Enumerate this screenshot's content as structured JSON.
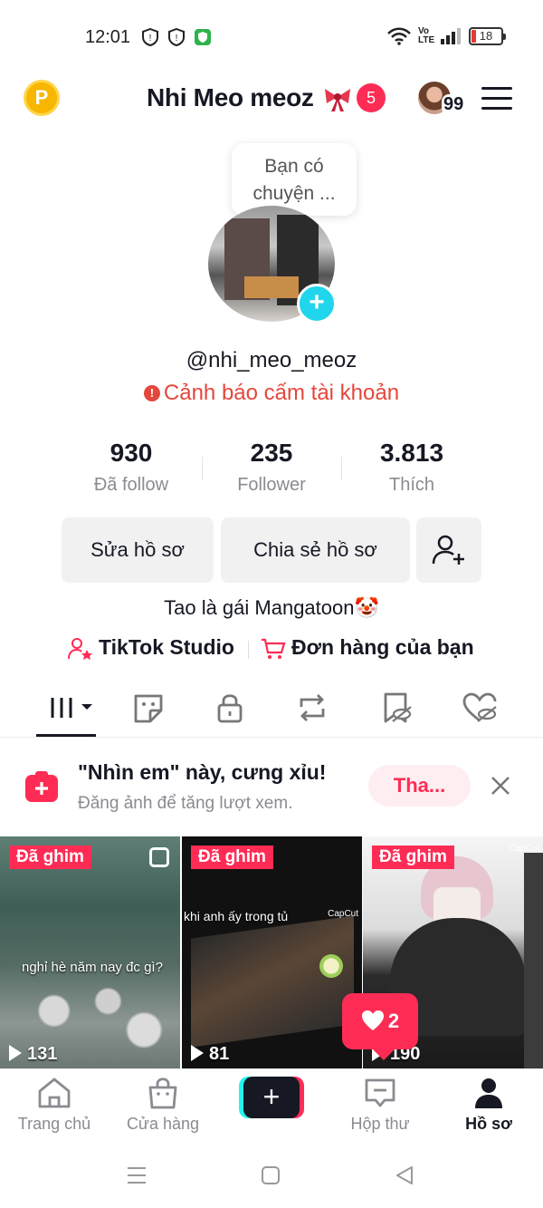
{
  "status_bar": {
    "time": "12:01",
    "network": "Vo LTE",
    "battery": "18"
  },
  "header": {
    "coin_label": "P",
    "title": "Nhi Meo meoz",
    "notification_count": "5",
    "friends_count": "99"
  },
  "profile": {
    "bubble_text_line1": "Bạn có",
    "bubble_text_line2": "chuyện ...",
    "handle": "@nhi_meo_meoz",
    "warning": "Cảnh báo cấm tài khoản",
    "stats": [
      {
        "value": "930",
        "label": "Đã follow"
      },
      {
        "value": "235",
        "label": "Follower"
      },
      {
        "value": "3.813",
        "label": "Thích"
      }
    ],
    "edit_button": "Sửa hồ sơ",
    "share_button": "Chia sẻ hồ sơ",
    "bio": "Tao là gái Mangatoon🤡",
    "studio_link": "TikTok Studio",
    "orders_link": "Đơn hàng của bạn"
  },
  "tabs": [
    "videos-grid",
    "stickers",
    "private",
    "reposts",
    "favorites",
    "liked"
  ],
  "promo": {
    "title": "\"Nhìn em\" này, cưng xỉu!",
    "subtitle": "Đăng ảnh để tăng lượt xem.",
    "button": "Tha..."
  },
  "videos": [
    {
      "badge": "Đã ghim",
      "caption": "nghỉ hè năm nay đc gì?",
      "views": "131"
    },
    {
      "badge": "Đã ghim",
      "caption": "khi anh ấy trong tủ",
      "watermark": "CapCut",
      "views": "81"
    },
    {
      "badge": "Đã ghim",
      "watermark": "CapCut",
      "views": "190"
    }
  ],
  "likes_popup": "2",
  "bottom_nav": [
    {
      "label": "Trang chủ",
      "icon": "home-icon"
    },
    {
      "label": "Cửa hàng",
      "icon": "shop-icon"
    },
    {
      "label": "",
      "icon": "create-icon"
    },
    {
      "label": "Hộp thư",
      "icon": "inbox-icon"
    },
    {
      "label": "Hồ sơ",
      "icon": "profile-icon"
    }
  ],
  "colors": {
    "accent": "#fe2c55",
    "cyan": "#25f4ee",
    "warning": "#e4473c",
    "coin": "#f7b600"
  }
}
